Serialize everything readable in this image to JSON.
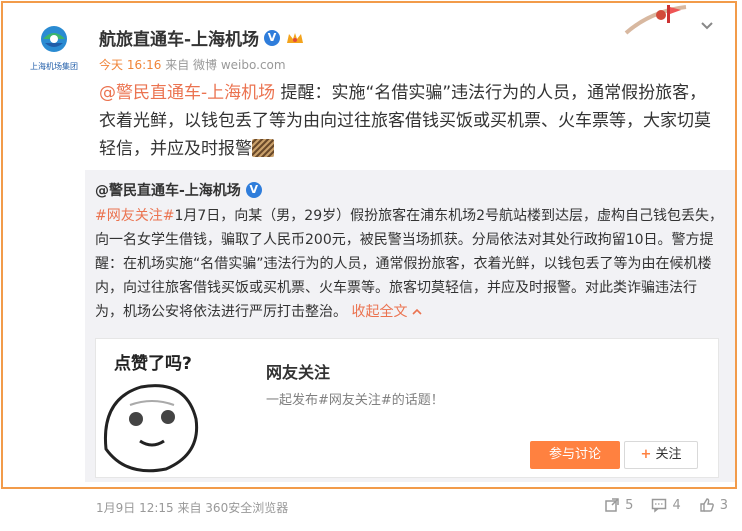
{
  "post": {
    "author": "航旅直通车-上海机场",
    "logo_text": "上海机场集团",
    "meta_time": "今天 16:16",
    "meta_source": "来自 微博 weibo.com",
    "mention": "@警民直通车-上海机场",
    "text": " 提醒：实施“名借实骗”违法行为的人员，通常假扮旅客，衣着光鲜，以钱包丢了等为由向过往旅客借钱买饭或买机票、火车票等，大家切莫轻信，并应及时报警"
  },
  "repost": {
    "author": "@警民直通车-上海机场",
    "tag": "#网友关注#",
    "text": "1月7日，向某（男，29岁）假扮旅客在浦东机场2号航站楼到达层，虚构自己钱包丢失，向一名女学生借钱，骗取了人民币200元，被民警当场抓获。分局依法对其处行政拘留10日。警方提醒：在机场实施“名借实骗”违法行为的人员，通常假扮旅客，衣着光鲜，以钱包丢了等为由在候机楼内，向过往旅客借钱买饭或买机票、火车票等。旅客切莫轻信，并应及时报警。对此类诈骗违法行为，机场公安将依法进行严厉打击整治。",
    "collapse_label": "收起全文",
    "card": {
      "image_caption": "点赞了吗?",
      "title": "网友关注",
      "description": "一起发布#网友关注#的话题！",
      "join_label": "参与讨论",
      "follow_label": "关注"
    }
  },
  "footer": {
    "meta": "1月9日 12:15 来自 360安全浏览器",
    "repost_count": "5",
    "comment_count": "4",
    "like_count": "3"
  },
  "colors": {
    "accent": "#eb7350",
    "button": "#ff8140",
    "border": "#f29b4a",
    "verify": "#2f7ddb"
  }
}
